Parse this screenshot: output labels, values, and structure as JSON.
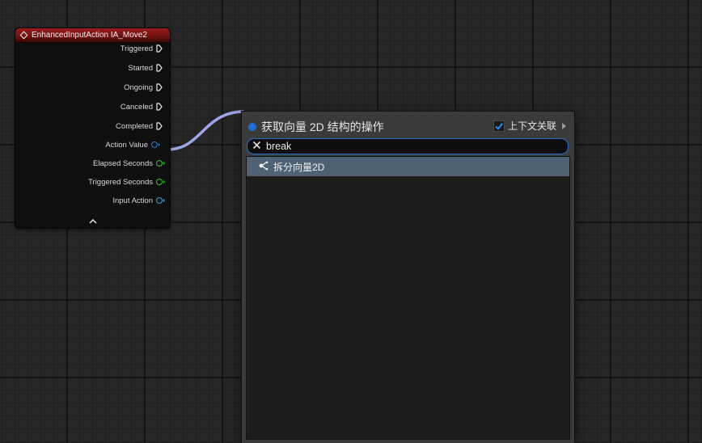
{
  "node": {
    "title": "EnhancedInputAction IA_Move2",
    "header_color": "#8b1717",
    "pins": [
      {
        "label": "Triggered",
        "type": "exec"
      },
      {
        "label": "Started",
        "type": "exec"
      },
      {
        "label": "Ongoing",
        "type": "exec"
      },
      {
        "label": "Canceled",
        "type": "exec"
      },
      {
        "label": "Completed",
        "type": "exec"
      },
      {
        "label": "Action Value",
        "type": "data",
        "color": "#2b7ad8"
      },
      {
        "label": "Elapsed Seconds",
        "type": "data",
        "color": "#38c23a"
      },
      {
        "label": "Triggered Seconds",
        "type": "data",
        "color": "#38c23a"
      },
      {
        "label": "Input Action",
        "type": "data",
        "color": "#2ea8e0"
      }
    ],
    "collapse_icon": "chevron-up-icon"
  },
  "wire": {
    "color": "#9ea6e8"
  },
  "context_menu": {
    "title": "获取向量 2D 结构的操作",
    "title_dot_color": "#1d6fd6",
    "context_sensitive_label": "上下文关联",
    "context_sensitive_checked": true,
    "search": {
      "value": "break",
      "clear_icon": "close-icon"
    },
    "results": [
      {
        "label": "拆分向量2D",
        "icon": "break-struct-icon",
        "selected": true
      }
    ],
    "selection_color": "#4f6274"
  }
}
